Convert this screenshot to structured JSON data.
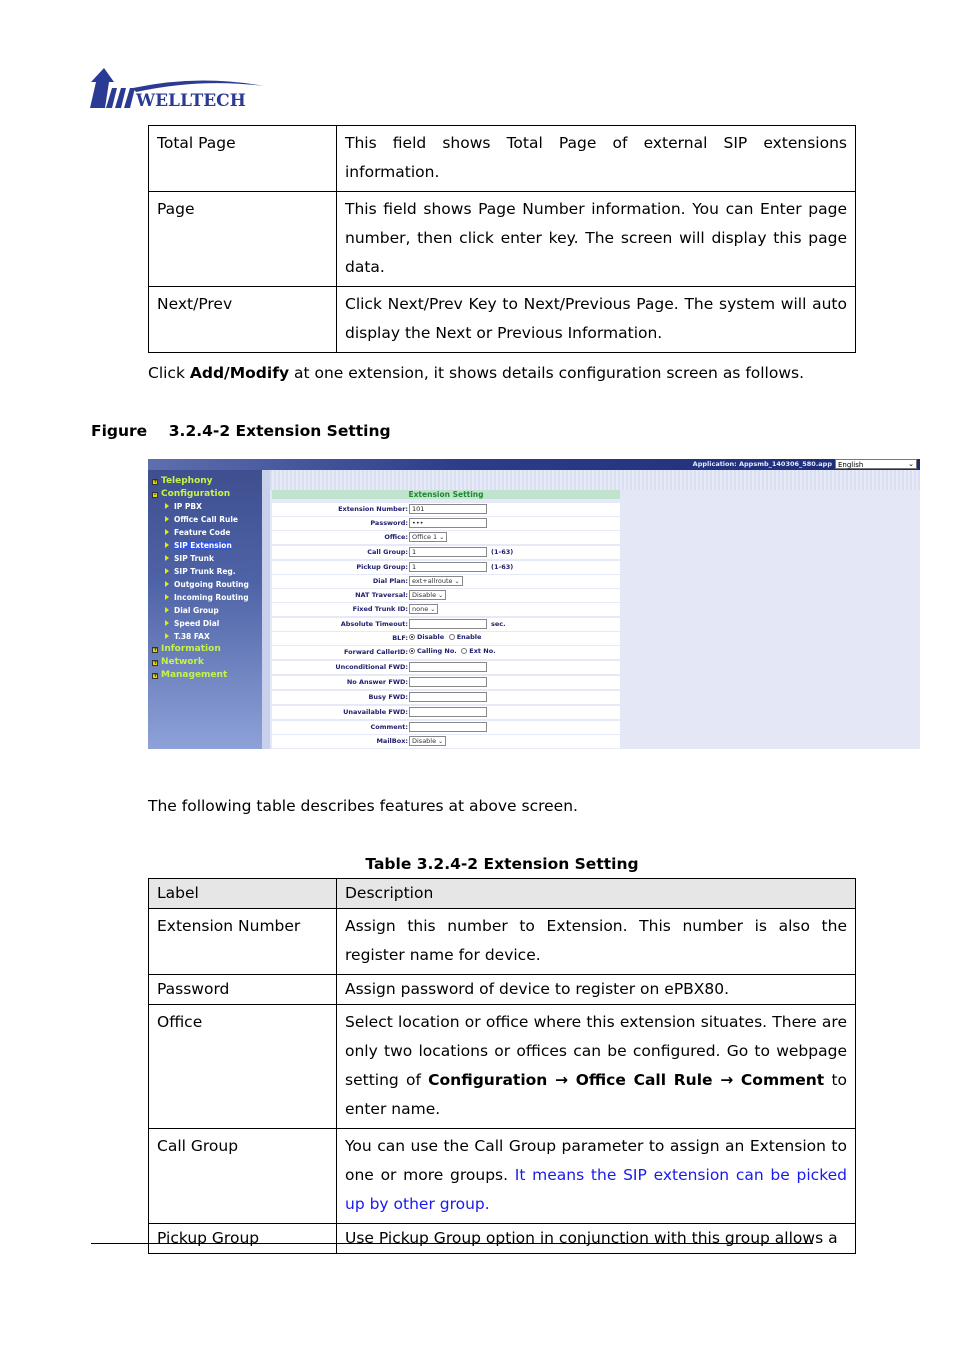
{
  "header": {
    "logo_text": "WELLTECH",
    "logo_color": "#2b3a93"
  },
  "top_table": {
    "rows": [
      {
        "label": "Total Page",
        "description": "This field shows Total Page of external SIP extensions information."
      },
      {
        "label": "Page",
        "description": "This field shows Page Number information. You can Enter page number, then click enter key. The screen will display this page data."
      },
      {
        "label": "Next/Prev",
        "description": "Click Next/Prev Key to Next/Previous Page. The system will auto display the Next or Previous Information."
      }
    ]
  },
  "intro": {
    "prefix": "Click ",
    "bold": "Add/Modify",
    "suffix": " at one extension, it shows details configuration screen as follows."
  },
  "figure_caption": "Figure    3.2.4-2 Extension Setting",
  "screenshot": {
    "app_label": "Application: Appsmb_140306_580.app",
    "language": "English",
    "nav": [
      {
        "label": "Telephony",
        "level": 0,
        "icon": "plus-box-icon"
      },
      {
        "label": "Configuration",
        "level": 0,
        "icon": "minus-box-icon"
      },
      {
        "label": "IP PBX",
        "level": 1
      },
      {
        "label": "Office Call Rule",
        "level": 1
      },
      {
        "label": "Feature Code",
        "level": 1
      },
      {
        "label": "SIP Extension",
        "level": 1,
        "active": true
      },
      {
        "label": "SIP Trunk",
        "level": 1
      },
      {
        "label": "SIP Trunk Reg.",
        "level": 1
      },
      {
        "label": "Outgoing Routing",
        "level": 1
      },
      {
        "label": "Incoming Routing",
        "level": 1
      },
      {
        "label": "Dial Group",
        "level": 1
      },
      {
        "label": "Speed Dial",
        "level": 1
      },
      {
        "label": "T.38 FAX",
        "level": 1
      },
      {
        "label": "Information",
        "level": 0,
        "icon": "plus-box-icon"
      },
      {
        "label": "Network",
        "level": 0,
        "icon": "plus-box-icon"
      },
      {
        "label": "Management",
        "level": 0,
        "icon": "plus-box-icon"
      }
    ],
    "form": {
      "title": "Extension Setting",
      "fields": {
        "extension_number": {
          "label": "Extension Number:",
          "value": "101"
        },
        "password": {
          "label": "Password:",
          "value": "•••"
        },
        "office": {
          "label": "Office:",
          "value": "Office 1"
        },
        "call_group": {
          "label": "Call Group:",
          "value": "1",
          "hint": "(1-63)"
        },
        "pickup_group": {
          "label": "Pickup Group:",
          "value": "1",
          "hint": "(1-63)"
        },
        "dial_plan": {
          "label": "Dial Plan:",
          "value": "ext+allroute"
        },
        "nat_traversal": {
          "label": "NAT Traversal:",
          "value": "Disable"
        },
        "fixed_trunk_id": {
          "label": "Fixed Trunk ID:",
          "value": "none"
        },
        "absolute_timeout": {
          "label": "Absolute Timeout:",
          "value": "",
          "hint": "sec."
        },
        "blf": {
          "label": "BLF:",
          "options": [
            "Disable",
            "Enable"
          ],
          "selected": "Disable"
        },
        "forward_callerid": {
          "label": "Forward CallerID:",
          "options": [
            "Calling No.",
            "Ext No."
          ],
          "selected": "Calling No."
        },
        "unconditional_fwd": {
          "label": "Unconditional FWD:",
          "value": ""
        },
        "no_answer_fwd": {
          "label": "No Answer FWD:",
          "value": ""
        },
        "busy_fwd": {
          "label": "Busy FWD:",
          "value": ""
        },
        "unavailable_fwd": {
          "label": "Unavailable FWD:",
          "value": ""
        },
        "comment": {
          "label": "Comment:",
          "value": ""
        },
        "mailbox": {
          "label": "MailBox:",
          "value": "Disable"
        }
      }
    }
  },
  "following_text": "The following table describes features at above screen.",
  "table_caption": "Table 3.2.4-2 Extension Setting",
  "main_table": {
    "headers": [
      "Label",
      "Description"
    ],
    "rows": [
      {
        "label": "Extension Number",
        "description": "Assign this number to Extension. This number is also the register name for device."
      },
      {
        "label": "Password",
        "description": "Assign password of device to register on ePBX80."
      },
      {
        "label": "Office",
        "desc_parts": {
          "a": "Select location or office where this extension situates. There are only two locations or offices can be configured. Go to webpage setting of ",
          "b1": "Configuration",
          "arrow": " → ",
          "b2": "Office Call Rule",
          "b3": "Comment",
          "c": " to enter name."
        }
      },
      {
        "label": "Call Group",
        "desc_parts": {
          "a": "You can use the Call Group parameter to assign an Extension to one or more groups. ",
          "blue": "It means the SIP extension can be picked up by other group."
        }
      },
      {
        "label": "Pickup Group",
        "description": "Use Pickup Group option in conjunction with this group allows a"
      }
    ]
  },
  "colors": {
    "link_blue": "#1a1aee",
    "table_header_bg": "#e6e6e6",
    "form_header_green": "#1e8a2f",
    "nav_top_green": "#c6f24a"
  }
}
